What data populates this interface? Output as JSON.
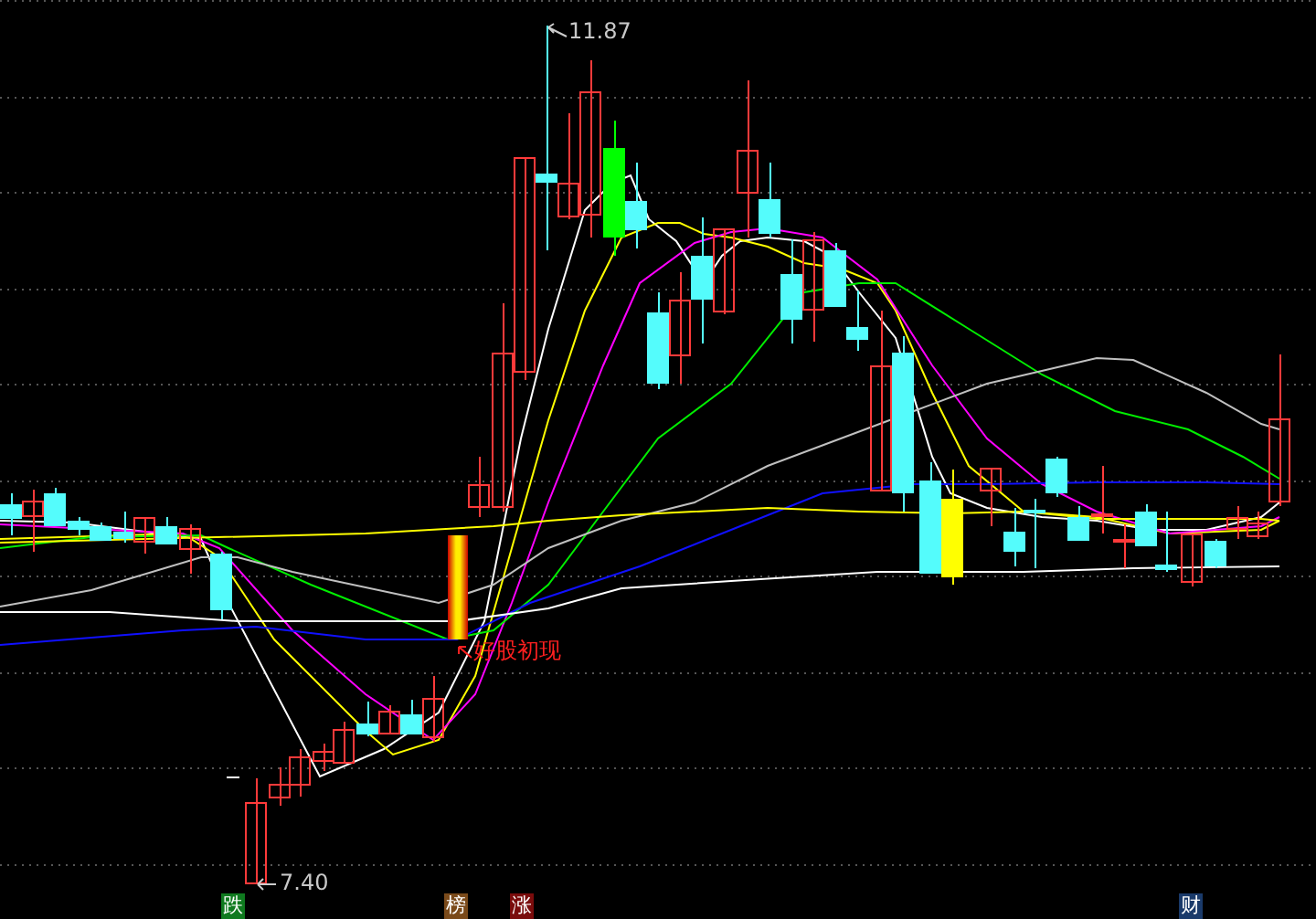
{
  "chart": {
    "high_label": "11.87",
    "low_label": "7.40",
    "signal": {
      "text": "好股初现"
    },
    "markers": [
      {
        "text": "跌",
        "color": "#0f7a1f"
      },
      {
        "text": "榜",
        "color": "#7a4a1a"
      },
      {
        "text": "涨",
        "color": "#7a0c0c"
      },
      {
        "text": "财",
        "color": "#1a3a6a"
      }
    ]
  }
}
